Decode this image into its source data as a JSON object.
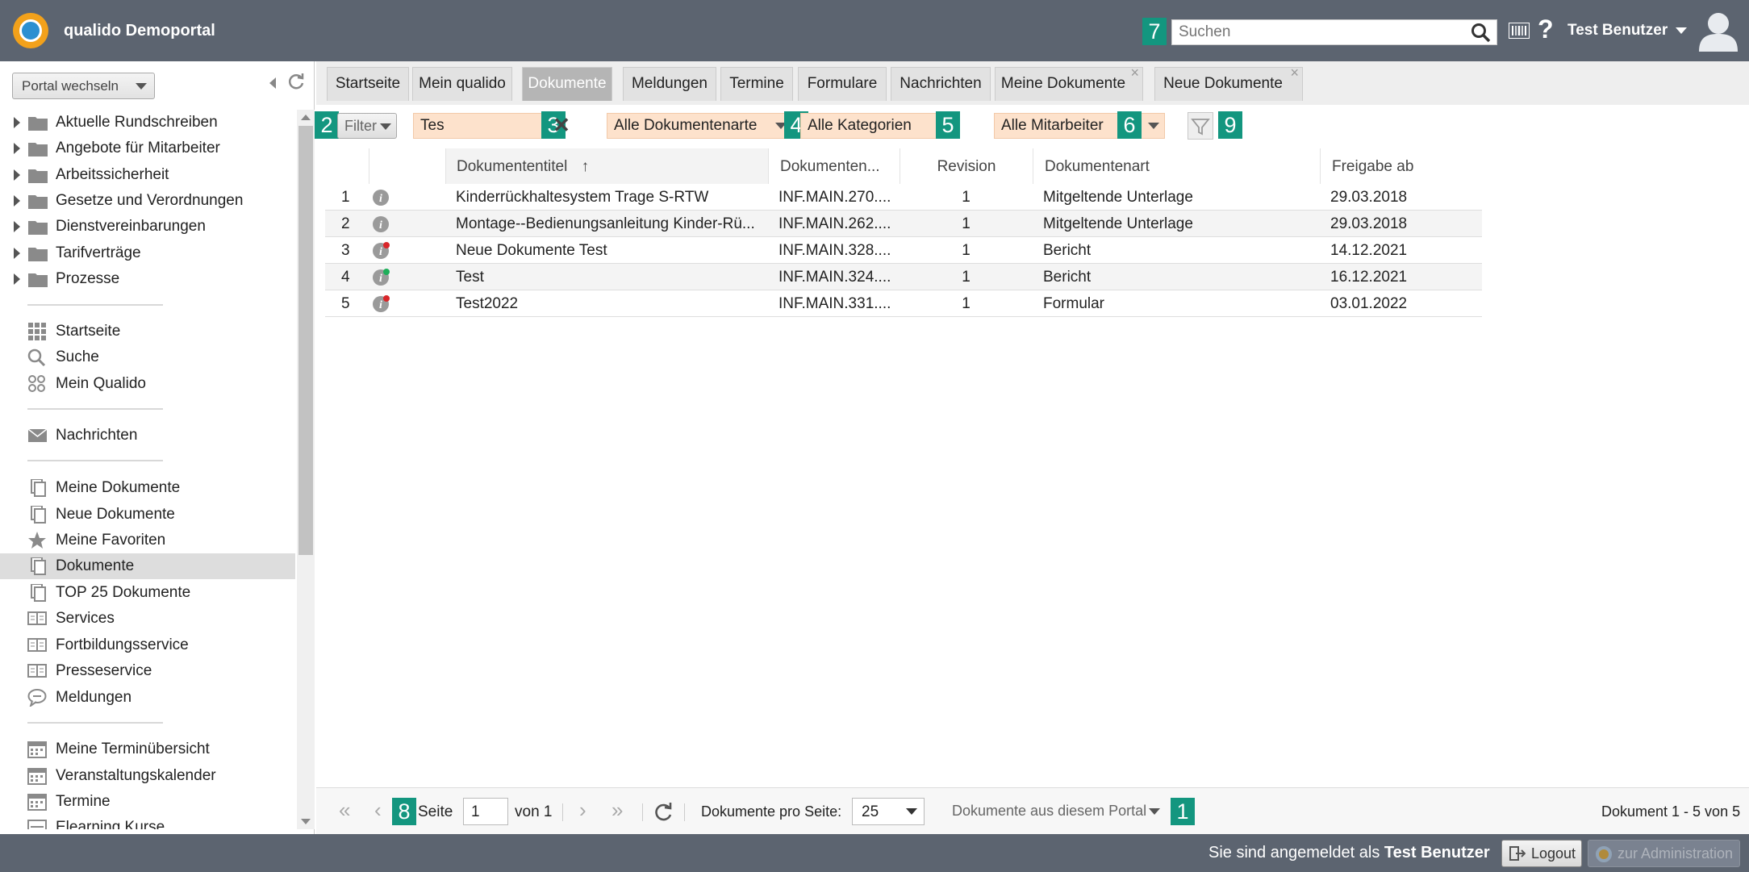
{
  "header": {
    "app_title": "qualido Demoportal",
    "search_placeholder": "Suchen",
    "user_name": "Test Benutzer"
  },
  "badges": {
    "b1": "1",
    "b2": "2",
    "b3": "3",
    "b4": "4",
    "b5": "5",
    "b6": "6",
    "b7": "7",
    "b8": "8",
    "b9": "9"
  },
  "sidebar": {
    "portal_switch": "Portal wechseln",
    "folders": [
      "Aktuelle Rundschreiben",
      "Angebote für Mitarbeiter",
      "Arbeitssicherheit",
      "Gesetze und Verordnungen",
      "Dienstvereinbarungen",
      "Tarifverträge",
      "Prozesse"
    ],
    "group1": [
      "Startseite",
      "Suche",
      "Mein Qualido"
    ],
    "group2": [
      "Nachrichten"
    ],
    "group3": [
      "Meine Dokumente",
      "Neue Dokumente",
      "Meine Favoriten",
      "Dokumente",
      "TOP 25 Dokumente",
      "Services",
      "Fortbildungsservice",
      "Presseservice",
      "Meldungen"
    ],
    "group4": [
      "Meine Terminübersicht",
      "Veranstaltungskalender",
      "Termine",
      "Elearning Kurse"
    ],
    "active_item": "Dokumente"
  },
  "tabs": [
    "Startseite",
    "Mein qualido",
    "Dokumente",
    "Meldungen",
    "Termine",
    "Formulare",
    "Nachrichten",
    "Meine Dokumente",
    "Neue Dokumente"
  ],
  "active_tab": "Dokumente",
  "filters": {
    "filter_button": "Filter",
    "text_value": "Tes",
    "doc_type": "Alle Dokumentenarte",
    "category": "Alle Kategorien",
    "employee": "Alle Mitarbeiter"
  },
  "table": {
    "headers": [
      "Dokumententitel",
      "Dokumenten...",
      "Revision",
      "Dokumentenart",
      "Freigabe ab"
    ],
    "rows": [
      {
        "n": "1",
        "title": "Kinderrückhaltesystem Trage S-RTW",
        "code": "INF.MAIN.270....",
        "rev": "1",
        "type": "Mitgeltende Unterlage",
        "date": "29.03.2018",
        "badge": ""
      },
      {
        "n": "2",
        "title": "Montage--Bedienungsanleitung Kinder-Rü...",
        "code": "INF.MAIN.262....",
        "rev": "1",
        "type": "Mitgeltende Unterlage",
        "date": "29.03.2018",
        "badge": ""
      },
      {
        "n": "3",
        "title": "Neue Dokumente Test",
        "code": "INF.MAIN.328....",
        "rev": "1",
        "type": "Bericht",
        "date": "14.12.2021",
        "badge": "red"
      },
      {
        "n": "4",
        "title": "Test",
        "code": "INF.MAIN.324....",
        "rev": "1",
        "type": "Bericht",
        "date": "16.12.2021",
        "badge": "green"
      },
      {
        "n": "5",
        "title": "Test2022",
        "code": "INF.MAIN.331....",
        "rev": "1",
        "type": "Formular",
        "date": "03.01.2022",
        "badge": "red"
      }
    ]
  },
  "pager": {
    "page_label": "Seite",
    "page_value": "1",
    "of_label": "von 1",
    "per_page_label": "Dokumente pro Seite:",
    "per_page_value": "25",
    "scope": "Dokumente aus diesem Portal",
    "summary": "Dokument 1 - 5 von 5"
  },
  "footer": {
    "logged_in_prefix": "Sie sind angemeldet als",
    "logged_in_user": "Test Benutzer",
    "logout": "Logout",
    "admin": "zur Administration"
  },
  "colors": {
    "topbar": "#5c6470",
    "badge": "#13967f",
    "filter_bg": "#fde2cc"
  }
}
